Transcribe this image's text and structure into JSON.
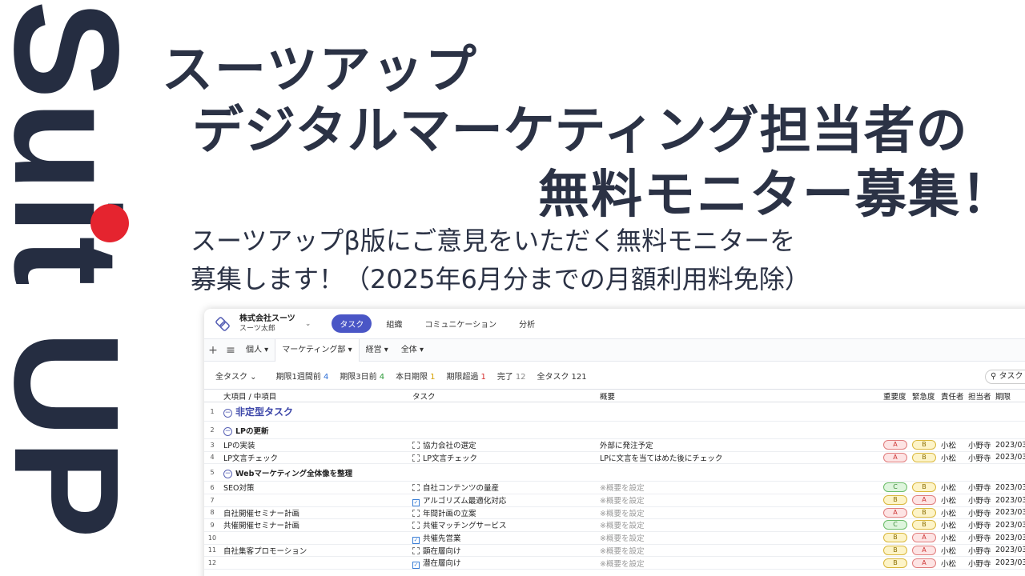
{
  "brand": {
    "logo_text": "Suit UP"
  },
  "headline": {
    "line1": "スーツアップ",
    "line2": "デジタルマーケティング担当者の",
    "line3": "無料モニター募集！"
  },
  "subtitle": {
    "line1": "スーツアップβ版にご意見をいただく無料モニターを",
    "line2": "募集します！（2025年6月分までの月額利用料免除）"
  },
  "app": {
    "company_name": "株式会社スーツ",
    "user_name": "スーツ太郎",
    "nav_tabs": [
      "タスク",
      "組織",
      "コミュニケーション",
      "分析"
    ],
    "active_nav": "タスク",
    "filter_tabs": [
      "個人 ▾",
      "マーケティング部 ▾",
      "経営 ▾",
      "全体 ▾"
    ],
    "active_filter": "マーケティング部 ▾",
    "task_selector": "全タスク ⌄",
    "stats": [
      {
        "label": "期限1週間前",
        "value": "4",
        "color": "#2f6fd6"
      },
      {
        "label": "期限3日前",
        "value": "4",
        "color": "#2e9b3a"
      },
      {
        "label": "本日期限",
        "value": "1",
        "color": "#d6a100"
      },
      {
        "label": "期限超過",
        "value": "1",
        "color": "#d63030"
      },
      {
        "label": "完了",
        "value": "12",
        "color": "#888888"
      },
      {
        "label": "全タスク",
        "value": "121",
        "color": "#333333"
      }
    ],
    "search_placeholder": "タスク",
    "columns": [
      "大項目 / 中項目",
      "タスク",
      "概要",
      "重要度",
      "緊急度",
      "責任者",
      "担当者",
      "期限"
    ],
    "rows": [
      {
        "n": "1",
        "type": "group-big",
        "title": "非定型タスク"
      },
      {
        "n": "2",
        "type": "group",
        "title": "LPの更新"
      },
      {
        "n": "3",
        "type": "task",
        "item": "LPの実装",
        "task": "協力会社の選定",
        "done": false,
        "summary": "外部に発注予定",
        "imp": "A",
        "urg": "B",
        "owner": "小松",
        "assignee": "小野寺",
        "due": "2023/03"
      },
      {
        "n": "4",
        "type": "task",
        "item": "LP文言チェック",
        "task": "LP文言チェック",
        "done": false,
        "summary": "LPに文言を当てはめた後にチェック",
        "imp": "A",
        "urg": "B",
        "owner": "小松",
        "assignee": "小野寺",
        "due": "2023/03"
      },
      {
        "n": "5",
        "type": "group",
        "title": "Webマーケティング全体像を整理"
      },
      {
        "n": "6",
        "type": "task",
        "item": "SEO対策",
        "task": "自社コンテンツの量産",
        "done": false,
        "summary": "※概要を設定",
        "imp": "C",
        "urg": "B",
        "owner": "小松",
        "assignee": "小野寺",
        "due": "2023/03"
      },
      {
        "n": "7",
        "type": "task",
        "item": "",
        "task": "アルゴリズム最適化対応",
        "done": true,
        "summary": "※概要を設定",
        "imp": "B",
        "urg": "A",
        "owner": "小松",
        "assignee": "小野寺",
        "due": "2023/03"
      },
      {
        "n": "8",
        "type": "task",
        "item": "自社開催セミナー計画",
        "task": "年間計画の立案",
        "done": false,
        "summary": "※概要を設定",
        "imp": "A",
        "urg": "B",
        "owner": "小松",
        "assignee": "小野寺",
        "due": "2023/03"
      },
      {
        "n": "9",
        "type": "task",
        "item": "共催開催セミナー計画",
        "task": "共催マッチングサービス",
        "done": false,
        "summary": "※概要を設定",
        "imp": "C",
        "urg": "B",
        "owner": "小松",
        "assignee": "小野寺",
        "due": "2023/03"
      },
      {
        "n": "10",
        "type": "task",
        "item": "",
        "task": "共催先営業",
        "done": true,
        "summary": "※概要を設定",
        "imp": "B",
        "urg": "A",
        "owner": "小松",
        "assignee": "小野寺",
        "due": "2023/03"
      },
      {
        "n": "11",
        "type": "task",
        "item": "自社集客プロモーション",
        "task": "顕在層向け",
        "done": false,
        "summary": "※概要を設定",
        "imp": "B",
        "urg": "A",
        "owner": "小松",
        "assignee": "小野寺",
        "due": "2023/03"
      },
      {
        "n": "12",
        "type": "task",
        "item": "",
        "task": "潜在層向け",
        "done": true,
        "summary": "※概要を設定",
        "imp": "B",
        "urg": "A",
        "owner": "小松",
        "assignee": "小野寺",
        "due": "2023/03"
      }
    ]
  }
}
